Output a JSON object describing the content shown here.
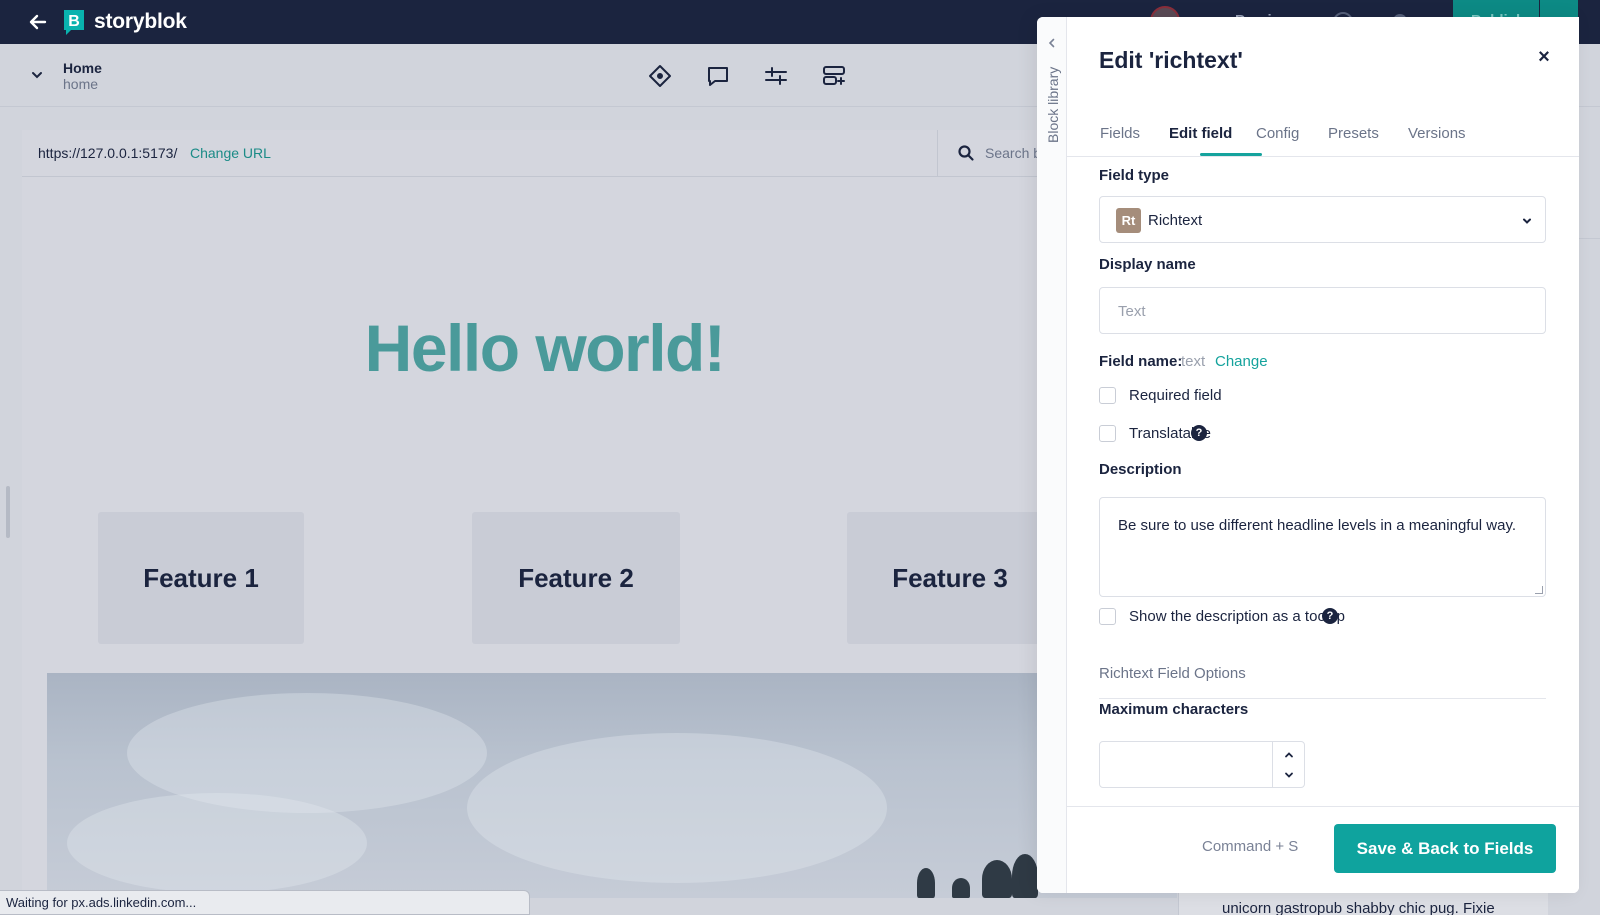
{
  "topbar": {
    "brand": "storyblok",
    "preview_label": "Preview",
    "publish_label": "Publish",
    "colors": {
      "bg": "#1b243f",
      "accent": "#0fa39e"
    }
  },
  "story": {
    "title": "Home",
    "slug": "home"
  },
  "toolbar": {
    "icons": [
      "diamond-icon",
      "comment-icon",
      "sliders-icon",
      "add-block-icon"
    ]
  },
  "preview": {
    "url": "https://127.0.0.1:5173/",
    "change_url": "Change URL",
    "search_placeholder": "Search b",
    "hero_title": "Hello world!",
    "features": [
      "Feature 1",
      "Feature 2",
      "Feature 3"
    ],
    "hero_title_color": "#4a9a9a"
  },
  "status_bar": {
    "text": "Waiting for px.ads.linkedin.com..."
  },
  "behind": {
    "text": "unicorn gastropub shabby chic pug. Fixie"
  },
  "drawer": {
    "rail_label": "Block library",
    "title": "Edit 'richtext'",
    "close_symbol": "×",
    "tabs": [
      "Fields",
      "Edit field",
      "Config",
      "Presets",
      "Versions"
    ],
    "active_tab": "Edit field",
    "field_type": {
      "label": "Field type",
      "badge": "Rt",
      "value": "Richtext"
    },
    "display_name": {
      "label": "Display name",
      "placeholder": "Text"
    },
    "field_name": {
      "label": "Field name:",
      "value": "text",
      "change": "Change"
    },
    "required": {
      "label": "Required field",
      "checked": false
    },
    "translatable": {
      "label": "Translatable",
      "checked": false,
      "help": "?"
    },
    "description": {
      "label": "Description",
      "value": "Be sure to use different headline levels in a meaningful way."
    },
    "tooltip_option": {
      "label": "Show the description as a tooltip",
      "checked": false,
      "help": "?"
    },
    "options_section": "Richtext Field Options",
    "max_chars": {
      "label": "Maximum characters",
      "value": ""
    },
    "footer": {
      "shortcut": "Command + S",
      "save_label": "Save & Back to Fields"
    }
  }
}
